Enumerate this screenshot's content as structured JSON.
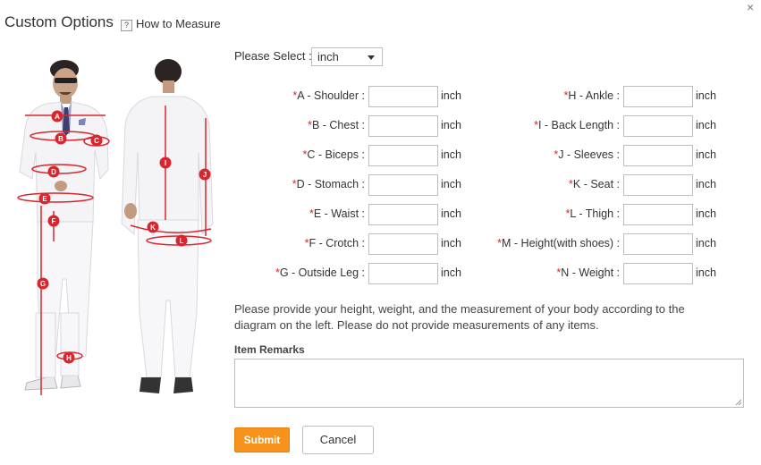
{
  "dialog": {
    "title": "Custom Options",
    "help_icon_glyph": "?",
    "help_link": "How to Measure",
    "close_glyph": "×"
  },
  "unit_select": {
    "label": "Please Select :",
    "value": "inch"
  },
  "required_mark": "*",
  "fields_left": [
    {
      "label": "A - Shoulder :",
      "unit": "inch",
      "value": ""
    },
    {
      "label": "B - Chest :",
      "unit": "inch",
      "value": ""
    },
    {
      "label": "C - Biceps :",
      "unit": "inch",
      "value": ""
    },
    {
      "label": "D - Stomach :",
      "unit": "inch",
      "value": ""
    },
    {
      "label": "E - Waist :",
      "unit": "inch",
      "value": ""
    },
    {
      "label": "F - Crotch :",
      "unit": "inch",
      "value": ""
    },
    {
      "label": "G - Outside Leg :",
      "unit": "inch",
      "value": ""
    }
  ],
  "fields_right": [
    {
      "label": "H - Ankle :",
      "unit": "inch",
      "value": ""
    },
    {
      "label": "I - Back Length :",
      "unit": "inch",
      "value": ""
    },
    {
      "label": "J - Sleeves :",
      "unit": "inch",
      "value": ""
    },
    {
      "label": "K - Seat :",
      "unit": "inch",
      "value": ""
    },
    {
      "label": "L - Thigh :",
      "unit": "inch",
      "value": ""
    },
    {
      "label": "M - Height(with shoes) :",
      "unit": "inch",
      "value": ""
    },
    {
      "label": "N - Weight :",
      "unit": "inch",
      "value": ""
    }
  ],
  "diagram_markers": [
    "A",
    "B",
    "C",
    "D",
    "E",
    "F",
    "G",
    "H",
    "I",
    "J",
    "K",
    "L"
  ],
  "note": "Please provide your height, weight, and the measurement of your body according to the diagram on the left. Please do not provide measurements of any items.",
  "remarks": {
    "label": "Item Remarks",
    "value": ""
  },
  "buttons": {
    "submit": "Submit",
    "cancel": "Cancel"
  },
  "colors": {
    "accent": "#f7931d",
    "required": "#d9262e",
    "marker": "#d9262e"
  }
}
